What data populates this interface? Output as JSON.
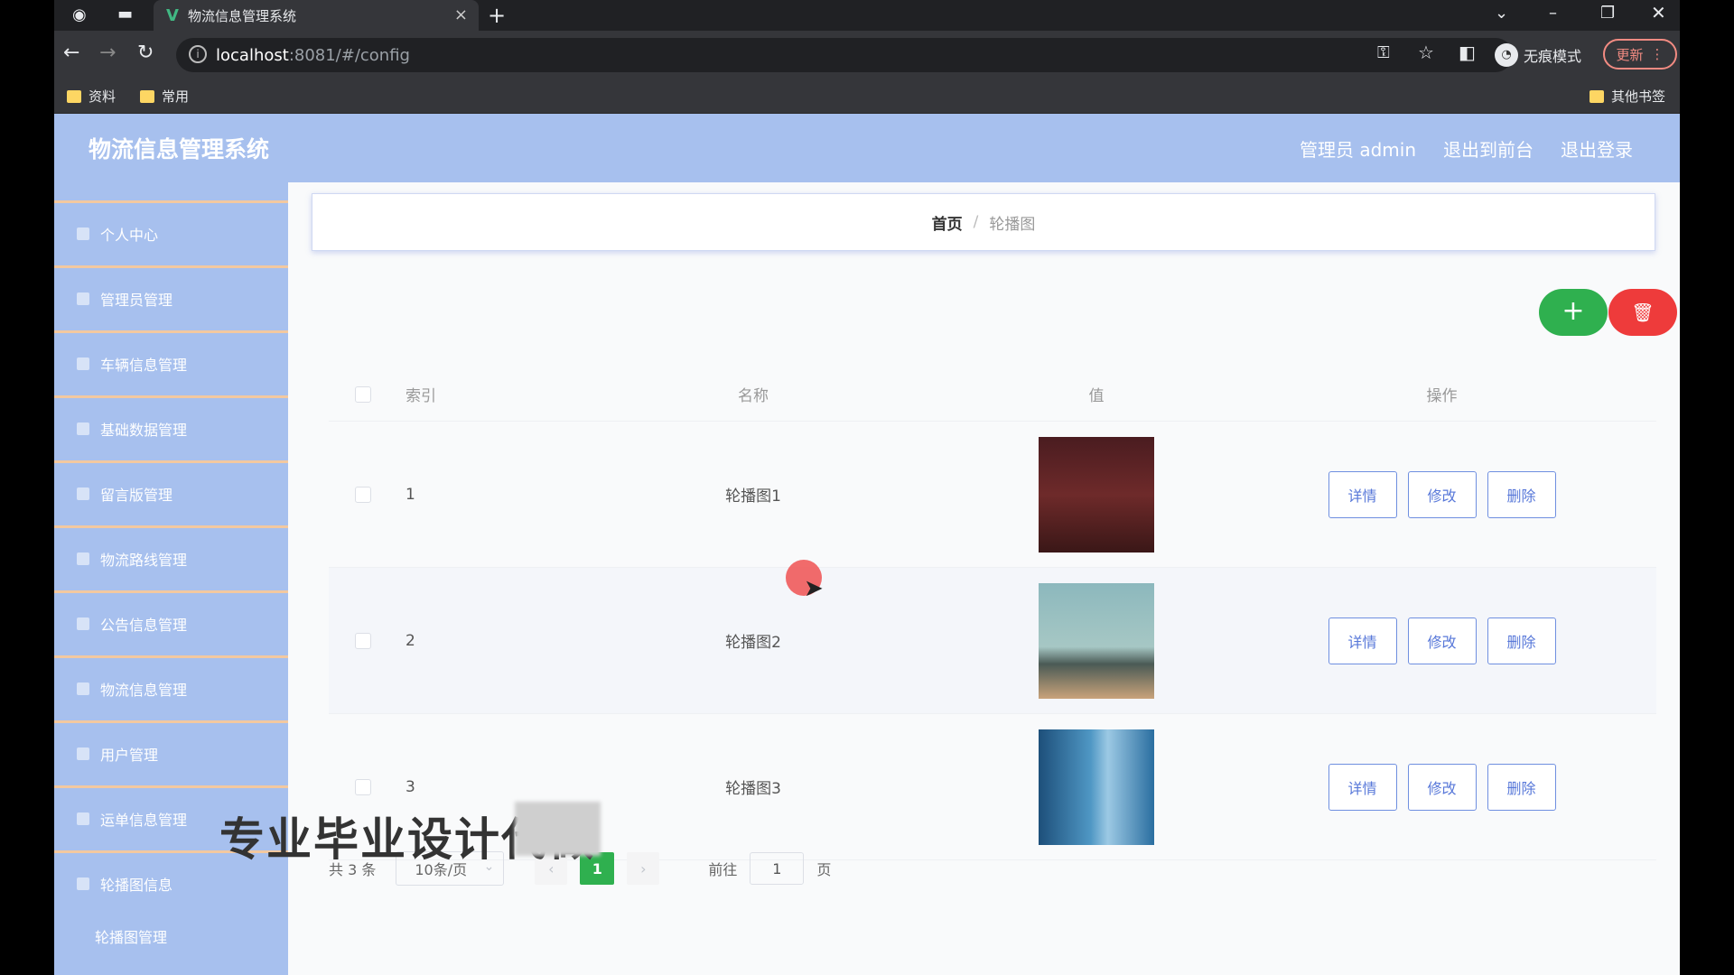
{
  "browser": {
    "tab_title": "物流信息管理系统",
    "url_host": "localhost",
    "url_path": ":8081/#/config",
    "incognito_label": "无痕模式",
    "update_label": "更新",
    "bookmarks": [
      "资料",
      "常用"
    ],
    "other_bookmarks": "其他书签"
  },
  "header": {
    "title": "物流信息管理系统",
    "admin_label": "管理员 admin",
    "front_label": "退出到前台",
    "logout_label": "退出登录"
  },
  "sidebar": {
    "items": [
      {
        "label": "个人中心",
        "icon": "user-icon"
      },
      {
        "label": "管理员管理",
        "icon": "admin-icon"
      },
      {
        "label": "车辆信息管理",
        "icon": "car-icon"
      },
      {
        "label": "基础数据管理",
        "icon": "bulb-icon"
      },
      {
        "label": "留言版管理",
        "icon": "message-icon"
      },
      {
        "label": "物流路线管理",
        "icon": "route-icon"
      },
      {
        "label": "公告信息管理",
        "icon": "notice-icon"
      },
      {
        "label": "物流信息管理",
        "icon": "logistics-icon"
      },
      {
        "label": "用户管理",
        "icon": "users-icon"
      },
      {
        "label": "运单信息管理",
        "icon": "waybill-icon"
      },
      {
        "label": "轮播图信息",
        "icon": "carousel-icon"
      }
    ],
    "subitem": "轮播图管理"
  },
  "breadcrumb": {
    "home": "首页",
    "separator": "/",
    "current": "轮播图"
  },
  "toolbar": {
    "add_symbol": "+",
    "delete_symbol": "🗑"
  },
  "table": {
    "headers": {
      "index": "索引",
      "name": "名称",
      "value": "值",
      "ops": "操作"
    },
    "rows": [
      {
        "index": "1",
        "name": "轮播图1"
      },
      {
        "index": "2",
        "name": "轮播图2"
      },
      {
        "index": "3",
        "name": "轮播图3"
      }
    ],
    "ops": {
      "detail": "详情",
      "edit": "修改",
      "delete": "删除"
    }
  },
  "pagination": {
    "total": "共 3 条",
    "page_size": "10条/页",
    "prev": "‹",
    "current_page": "1",
    "next": "›",
    "goto_label": "前往",
    "goto_value": "1",
    "page_suffix": "页"
  },
  "overlay": {
    "watermark": "专业毕业设计代做"
  }
}
